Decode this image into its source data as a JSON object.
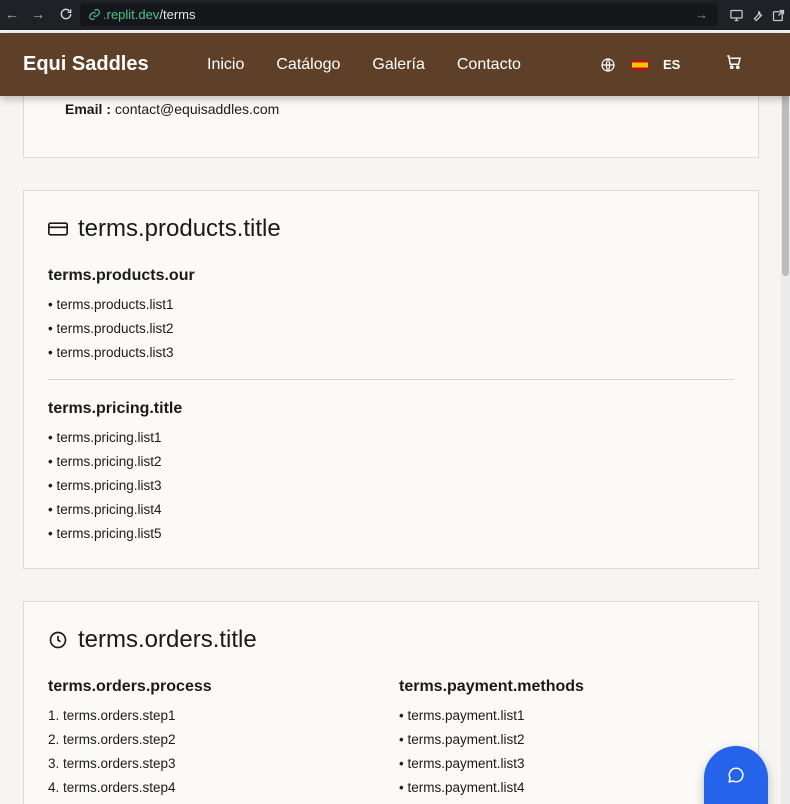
{
  "browser": {
    "url_host": ".replit.dev",
    "url_path": "/terms"
  },
  "header": {
    "brand": "Equi Saddles",
    "nav": [
      "Inicio",
      "Catálogo",
      "Galería",
      "Contacto"
    ],
    "language": "ES"
  },
  "contact": {
    "email_label": "Email :",
    "email_value": "contact@equisaddles.com"
  },
  "products": {
    "title": "terms.products.title",
    "our": "terms.products.our",
    "list": [
      "terms.products.list1",
      "terms.products.list2",
      "terms.products.list3"
    ],
    "pricing_title": "terms.pricing.title",
    "pricing_list": [
      "terms.pricing.list1",
      "terms.pricing.list2",
      "terms.pricing.list3",
      "terms.pricing.list4",
      "terms.pricing.list5"
    ]
  },
  "orders": {
    "title": "terms.orders.title",
    "process": "terms.orders.process",
    "steps": [
      "terms.orders.step1",
      "terms.orders.step2",
      "terms.orders.step3",
      "terms.orders.step4"
    ],
    "payment_title": "terms.payment.methods",
    "payment_list": [
      "terms.payment.list1",
      "terms.payment.list2",
      "terms.payment.list3",
      "terms.payment.list4"
    ]
  }
}
